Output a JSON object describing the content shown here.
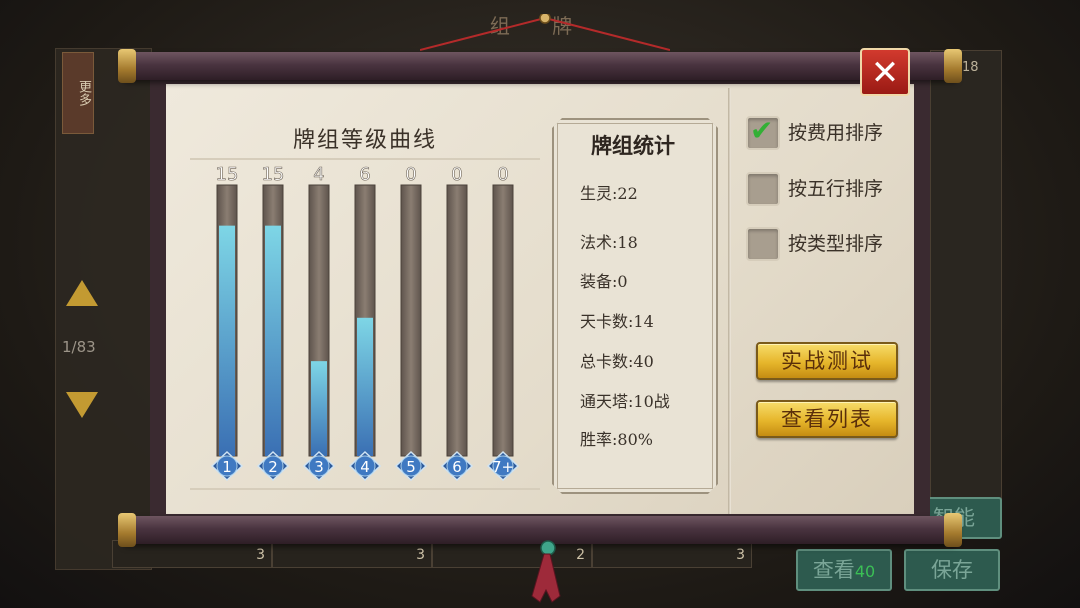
{
  "background": {
    "top_title": "组 牌",
    "more_label": "更多",
    "page_indicator": "1/83",
    "top_right_count": "18",
    "bottom_counts": [
      "3",
      "3",
      "2",
      "3"
    ],
    "view_button": "查看",
    "view_button_count": "40",
    "save_button": "保存",
    "smart_button": "智能"
  },
  "chart_data": {
    "type": "bar",
    "title": "牌组等级曲线",
    "categories": [
      "1",
      "2",
      "3",
      "4",
      "5",
      "6",
      "7+"
    ],
    "values": [
      15,
      15,
      4,
      6,
      0,
      0,
      0
    ],
    "value_labels": [
      "15",
      "15",
      "4",
      "6",
      "0",
      "0",
      "0"
    ],
    "bar_fill_fraction": [
      0.85,
      0.85,
      0.35,
      0.51,
      0,
      0,
      0
    ],
    "colors": {
      "bar_top": "#7ed6e6",
      "bar_bottom": "#3a6fb3",
      "track": "#7d7167",
      "badge": "#3a6fb3"
    }
  },
  "stats": {
    "title": "牌组统计",
    "rows": [
      "生灵:22",
      "法术:18",
      "装备:0",
      "天卡数:14",
      "总卡数:40",
      "通天塔:10战",
      "胜率:80%"
    ]
  },
  "sort_options": [
    {
      "label": "按费用排序",
      "checked": true
    },
    {
      "label": "按五行排序",
      "checked": false
    },
    {
      "label": "按类型排序",
      "checked": false
    }
  ],
  "buttons": {
    "battle_test": "实战测试",
    "view_list": "查看列表"
  },
  "close_label": "✕"
}
